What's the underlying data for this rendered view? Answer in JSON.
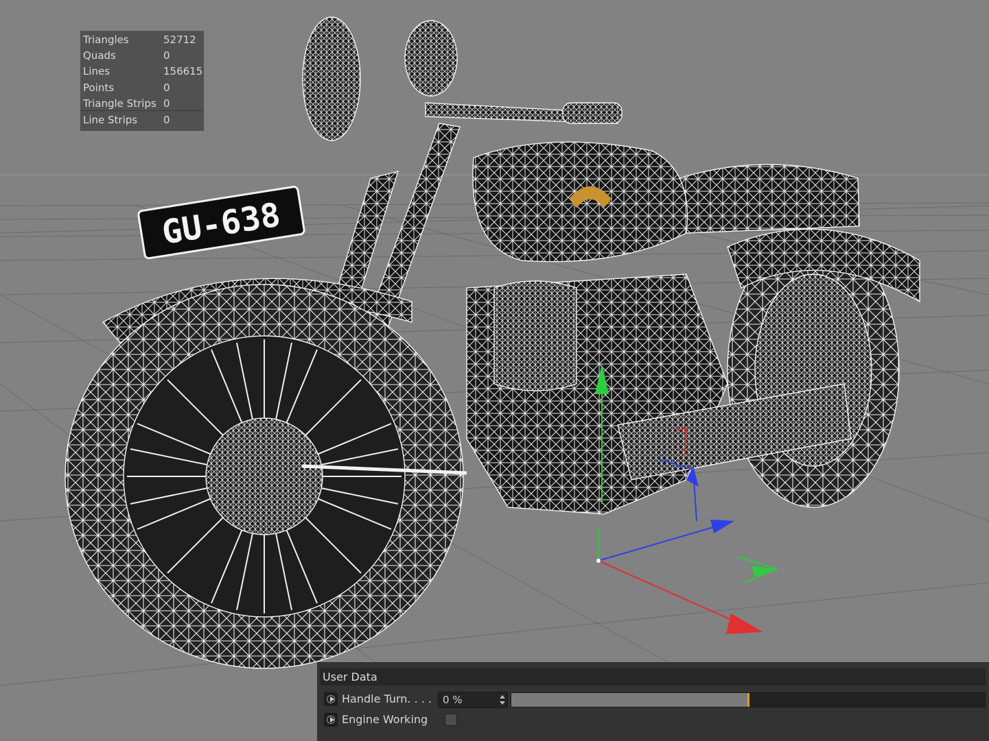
{
  "stats": [
    {
      "label": "Triangles",
      "value": "52712"
    },
    {
      "label": "Quads",
      "value": "0"
    },
    {
      "label": "Lines",
      "value": "156615"
    },
    {
      "label": "Points",
      "value": "0"
    },
    {
      "label": "Triangle Strips",
      "value": "0"
    },
    {
      "label": "Line Strips",
      "value": "0"
    }
  ],
  "plate_text": "GU-638",
  "user_data": {
    "title": "User Data",
    "handle_turn": {
      "label": "Handle Turn. . . .",
      "value": "0 %",
      "fill_fraction": 0.5
    },
    "engine_working": {
      "label": "Engine Working",
      "checked": false
    }
  },
  "colors": {
    "viewport_bg": "#828282",
    "wireframe": "#f2f2f2",
    "axis_x": "#e03030",
    "axis_y": "#2ecc40",
    "axis_z": "#2f3fe6",
    "keyframe_marker": "#e49a1b"
  },
  "icons": [
    "animation-keyframe-icon",
    "spin-arrows-icon",
    "checkbox-icon"
  ]
}
